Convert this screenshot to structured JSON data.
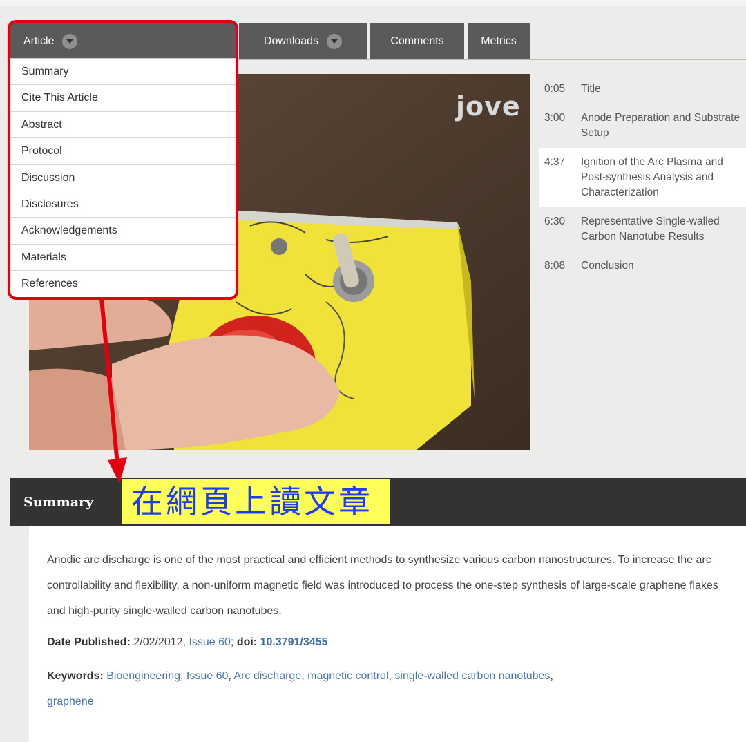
{
  "tabs": {
    "article": "Article",
    "downloads": "Downloads",
    "comments": "Comments",
    "metrics": "Metrics"
  },
  "menu": {
    "items": [
      "Summary",
      "Cite This Article",
      "Abstract",
      "Protocol",
      "Discussion",
      "Disclosures",
      "Acknowledgements",
      "Materials",
      "References"
    ]
  },
  "video": {
    "logo": "jove"
  },
  "chapters": [
    {
      "time": "0:05",
      "label": "Title"
    },
    {
      "time": "3:00",
      "label": "Anode Preparation and Substrate Setup"
    },
    {
      "time": "4:37",
      "label": "Ignition of the Arc Plasma and Post-synthesis Analysis and Characterization",
      "active": true
    },
    {
      "time": "6:30",
      "label": "Representative Single-walled Carbon Nanotube Results"
    },
    {
      "time": "8:08",
      "label": "Conclusion"
    }
  ],
  "summary": {
    "title": "Summary",
    "annotation": "在網頁上讀文章",
    "abstract": "Anodic arc discharge is one of the most practical and efficient methods to synthesize various carbon nanostructures. To increase the arc controllability and flexibility, a non-uniform magnetic field was introduced to process the one-step synthesis of large-scale graphene flakes and high-purity single-walled carbon nanotubes.",
    "date_label": "Date Published:",
    "date_value": "2/02/2012,",
    "issue_link": "Issue 60",
    "doi_label": "doi:",
    "doi_value": "10.3791/3455",
    "keywords_label": "Keywords:",
    "keywords": [
      "Bioengineering",
      "Issue 60",
      "Arc discharge",
      "magnetic control",
      "single-walled carbon nanotubes",
      "graphene"
    ]
  },
  "colors": {
    "tab_bg": "#5a5a5a",
    "highlight_red": "#e3000f",
    "annotation_bg": "#ffff5a",
    "annotation_text": "#1e3cf0",
    "link": "#4a76b0"
  }
}
